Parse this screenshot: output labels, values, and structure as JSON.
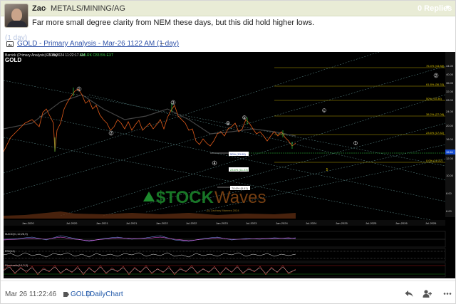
{
  "post": {
    "author": "Zac",
    "separator": "-",
    "category": "METALS/MINING/AG",
    "replies_label": "0 Replies",
    "text": "Far more small degree clarity from NEM these days, but this did hold higher lows.",
    "ghost_text": "(1 day)",
    "attachment": {
      "link_text": "GOLD - Primary Analysis - Mar-26 1122 AM (1 day)",
      "trailing": "–",
      "icon": "image-icon"
    },
    "timestamp": "Mar 26 11:22:46",
    "tags": [
      "GOLD",
      "DailyChart"
    ],
    "tag_separator": "|"
  },
  "chart": {
    "header_line": "Barrick (Primary Analysis) - 1 day",
    "header_date": "03/26/2024 11:22:17 AM",
    "header_price": "CHLRK C83.5% EXT",
    "symbol": "GOLD",
    "watermark": "$TOCKWaves",
    "copyright": "(c) Zachary Mannes 2024",
    "fib_labels": [
      "76.4% (44.88)",
      "61.8% (36.33)",
      "50% (33.38)",
      "38.2% (27.08)",
      "23.6% (17.82)",
      "50% (13.00)",
      "70.0% (13.12)",
      "23.6% (11.23)",
      "0.0% (12.22)",
      "78.6% (8.41)"
    ],
    "y_ticks": [
      "44.00",
      "40.00",
      "36.00",
      "32.00",
      "28.00",
      "24.00",
      "20.00",
      "16.00",
      "13.00",
      "12.00",
      "10.00",
      "8.00",
      "6.00"
    ],
    "x_ticks": [
      "Jan-2020",
      "Jul-2020",
      "Jan-2021",
      "Jul-2021",
      "Jan-2022",
      "Jul-2022",
      "Jan-2023",
      "Jul-2023",
      "Jan-2024",
      "Jul-2024",
      "Jan-2025",
      "Jul-2025",
      "Jan-2026",
      "Jul-2026"
    ],
    "wave_labels": [
      "1",
      "2",
      "3",
      "4",
      "5",
      "a",
      "b",
      "c",
      "1",
      "2"
    ],
    "indicators": [
      "MACD(C,12,26,9)",
      "RSI(14)",
      "Stochastic(14,3,3)"
    ],
    "price_last": "15.61",
    "colors": {
      "background": "#000000",
      "price": "#e05a1a",
      "fib": "#c9b200",
      "green_fib": "#2ecc40",
      "watermark_green": "#1d8a2d",
      "watermark_orange": "#8a4a16"
    }
  },
  "footer": {
    "reply_icon": "reply-icon",
    "follow_icon": "follow-user-icon",
    "more_icon": "more-icon"
  }
}
